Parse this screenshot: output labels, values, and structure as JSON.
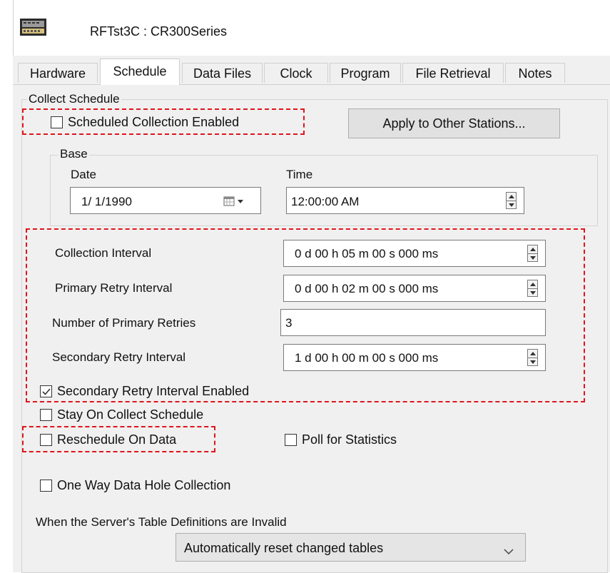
{
  "window": {
    "station_title": "RFTst3C : CR300Series",
    "station_icon": "datalogger-icon"
  },
  "tabs": [
    {
      "label": "Hardware",
      "active": false
    },
    {
      "label": "Schedule",
      "active": true
    },
    {
      "label": "Data Files",
      "active": false
    },
    {
      "label": "Clock",
      "active": false
    },
    {
      "label": "Program",
      "active": false
    },
    {
      "label": "File Retrieval",
      "active": false
    },
    {
      "label": "Notes",
      "active": false
    }
  ],
  "collect_schedule": {
    "group_title": "Collect Schedule",
    "scheduled_collection_enabled": {
      "label": "Scheduled Collection Enabled",
      "checked": false
    },
    "apply_button": "Apply to Other Stations...",
    "base": {
      "title": "Base",
      "date_label": "Date",
      "date_value": "1/ 1/1990",
      "time_label": "Time",
      "time_value": "12:00:00 AM"
    },
    "collection_interval": {
      "label": "Collection Interval",
      "value": "0 d 00 h 05 m 00 s 000 ms"
    },
    "primary_retry_interval": {
      "label": "Primary Retry Interval",
      "value": "0 d 00 h 02 m 00 s 000 ms"
    },
    "number_of_primary_retries": {
      "label": "Number of Primary Retries",
      "value": "3"
    },
    "secondary_retry_interval": {
      "label": "Secondary Retry Interval",
      "value": "1 d 00 h 00 m 00 s 000 ms"
    },
    "secondary_retry_interval_enabled": {
      "label": "Secondary Retry Interval Enabled",
      "checked": true
    },
    "stay_on_collect_schedule": {
      "label": "Stay On Collect Schedule",
      "checked": false
    },
    "reschedule_on_data": {
      "label": "Reschedule On Data",
      "checked": false
    },
    "poll_for_statistics": {
      "label": "Poll for Statistics",
      "checked": false
    },
    "one_way_data_hole_collection": {
      "label": "One Way Data Hole Collection",
      "checked": false
    },
    "table_defs_label": "When the Server's Table Definitions are Invalid",
    "table_defs_option": "Automatically reset changed tables"
  },
  "colors": {
    "highlight_dash": "#e0141b",
    "panel_bg": "#f0f0f0",
    "check_color": "#333333"
  }
}
